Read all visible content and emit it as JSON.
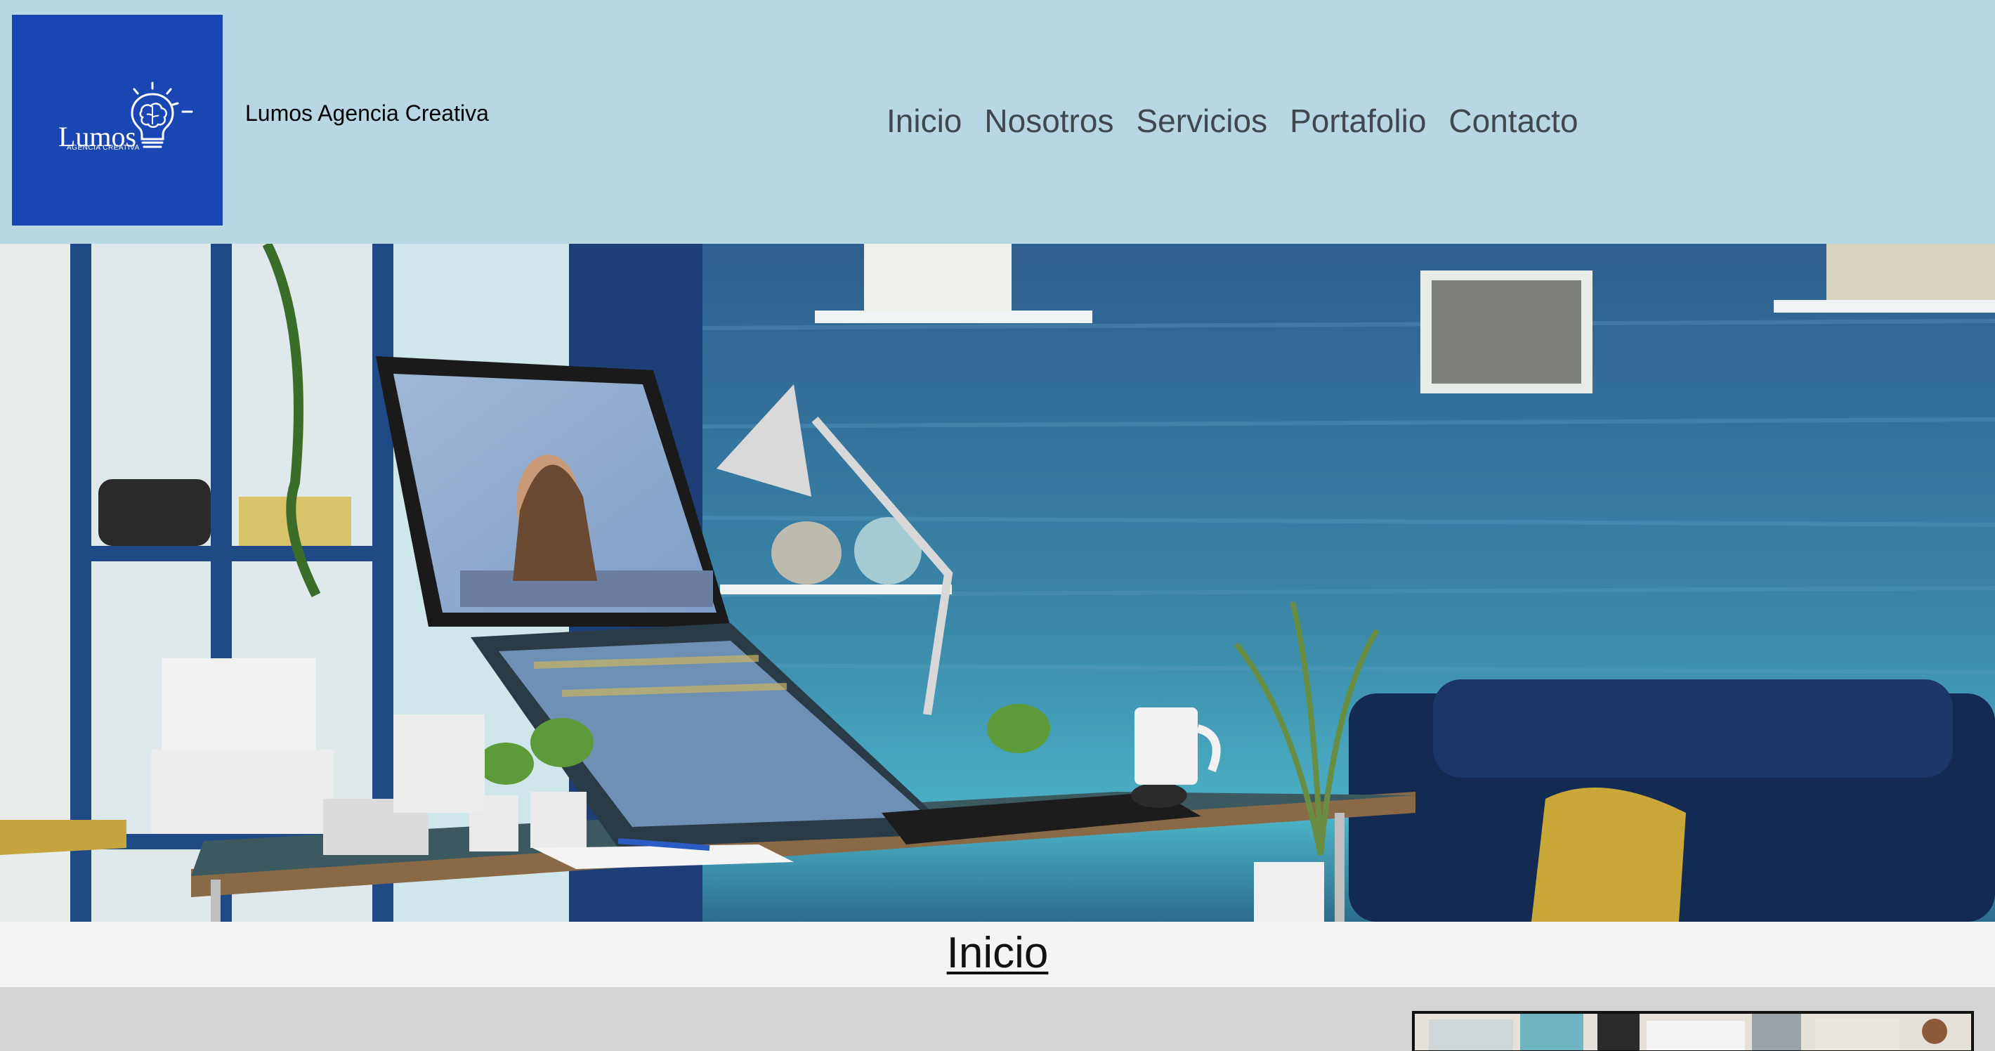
{
  "brand": {
    "logo_word": "Lumos",
    "logo_subtitle": "AGENCIA CREATIVA",
    "name": "Lumos Agencia Creativa"
  },
  "nav": {
    "items": [
      {
        "label": "Inicio"
      },
      {
        "label": "Nosotros"
      },
      {
        "label": "Servicios"
      },
      {
        "label": "Portafolio"
      },
      {
        "label": "Contacto"
      }
    ]
  },
  "section": {
    "title": "Inicio"
  },
  "colors": {
    "header_bg": "#b7d8e3",
    "logo_bg": "#1a46b3",
    "nav_text": "#3f484d",
    "title_band_bg": "#f4f4f4",
    "content_bg": "#d4d4d4"
  },
  "icons": {
    "logo_mark": "lightbulb-brain-icon"
  }
}
